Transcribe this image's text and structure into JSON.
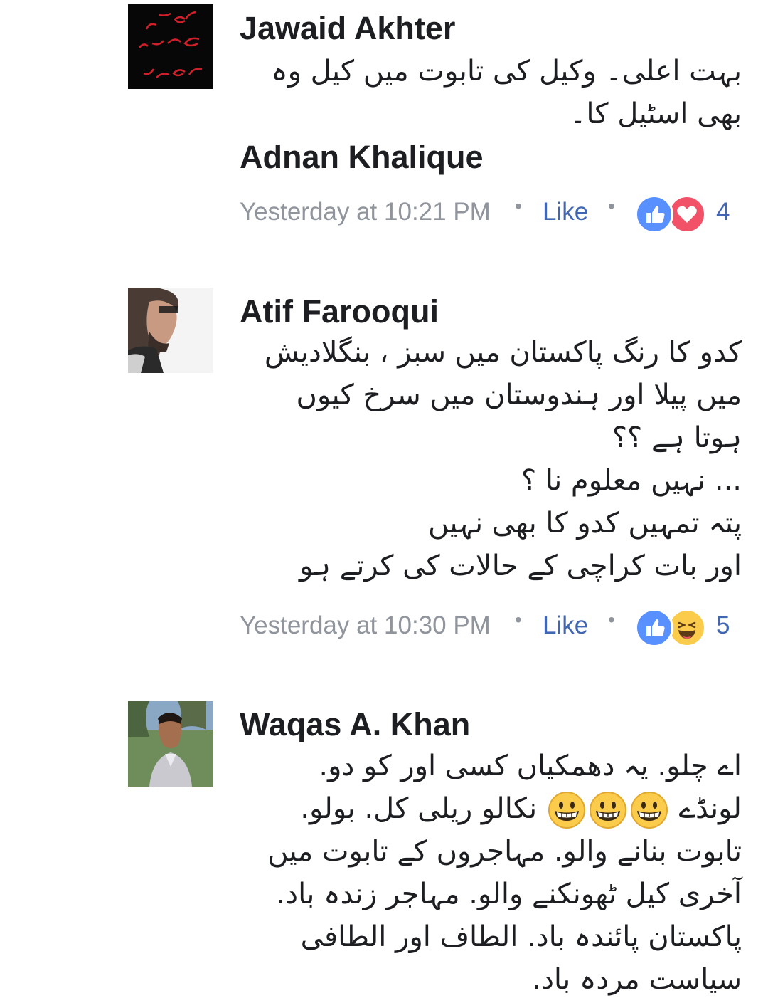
{
  "colors": {
    "like_blue": "#4267b2",
    "reaction_like": "#5890ff",
    "reaction_love": "#f25268",
    "reaction_haha": "#fbcb4c",
    "timestamp_gray": "#90949c",
    "author": "#1c1e21"
  },
  "comments": [
    {
      "author": "Jawaid Akhter",
      "body_lines": [
        "بہت اعلی۔ وکیل کی تابوت میں کیل وہ",
        "بھی اسٹیل کا۔"
      ],
      "mention": "Adnan Khalique",
      "timestamp": "Yesterday at 10:21 PM",
      "like_label": "Like",
      "reactions": [
        "like-icon",
        "love-icon"
      ],
      "reaction_count": "4"
    },
    {
      "author": "Atif Farooqui",
      "body_lines": [
        "کدو کا رنگ پاکستان میں سبز ، بنگلادیش",
        "میں پیلا اور ہندوستان میں سرخ کیوں",
        "ہوتا ہے ؟؟",
        "... نہیں معلوم نا ؟",
        "پتہ تمہیں کدو کا بھی نہیں",
        "اور بات کراچی کے حالات کی کرتے ہو"
      ],
      "timestamp": "Yesterday at 10:30 PM",
      "like_label": "Like",
      "reactions": [
        "like-icon",
        "haha-icon"
      ],
      "reaction_count": "5"
    },
    {
      "author": "Waqas A. Khan",
      "body_lines": [
        "اے چلو. یہ دھمکیاں کسی اور کو دو.",
        "لونڈے",
        "نکالو ریلی کل. بولو.",
        "تابوت بنانے والو. مہاجروں کے تابوت میں",
        "آخری کیل ٹھونکنے والو. مہاجر زندہ باد.",
        "پاکستان پائندہ باد. الطاف اور الطافی",
        "سیاست مردہ باد."
      ],
      "emoji_names": [
        "grinning-face-icon",
        "grinning-face-icon",
        "grinning-face-icon"
      ]
    }
  ]
}
